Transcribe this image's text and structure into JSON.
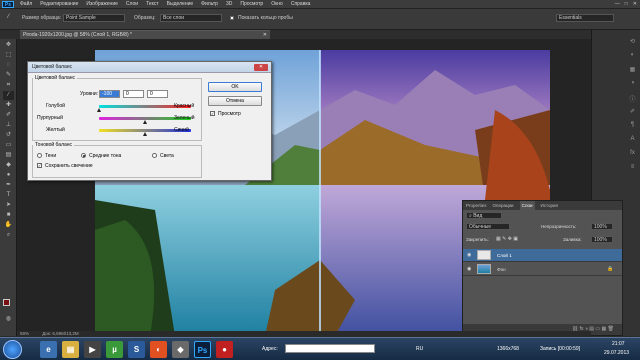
{
  "menubar": {
    "app_logo": "Ps",
    "items": [
      "Файл",
      "Редактирование",
      "Изображение",
      "Слои",
      "Текст",
      "Выделение",
      "Фильтр",
      "3D",
      "Просмотр",
      "Окно",
      "Справка"
    ],
    "win_min": "—",
    "win_max": "□",
    "win_close": "✕"
  },
  "options": {
    "sample_size_label": "Размер образца:",
    "sample_size_value": "Point Sample",
    "sample_label": "Образец:",
    "sample_value": "Все слои",
    "show_ring_label": "Показать кольцо пробы",
    "workspace": "Essentials"
  },
  "document": {
    "tab_title": "Piroda-1920x1200.jpg @ 58% (Слой 1, RGB/8) *",
    "tab_close": "✕",
    "zoom": "58%",
    "doc_size": "Док: 6,59M/13,2M"
  },
  "dialog": {
    "title": "Цветовой баланс",
    "color_balance_group": "Цветовой баланс",
    "levels_label": "Уровни:",
    "levels": [
      "-100",
      "0",
      "0"
    ],
    "sliders": [
      {
        "left": "Голубой",
        "right": "Красный",
        "value": -100
      },
      {
        "left": "Пурпурный",
        "right": "Зеленый",
        "value": 0
      },
      {
        "left": "Желтый",
        "right": "Синий",
        "value": 0
      }
    ],
    "tone_group": "Тоновой баланс",
    "tones": [
      "Тени",
      "Средние тона",
      "Света"
    ],
    "tone_selected": "Средние тона",
    "preserve_luminosity": "Сохранить свечение",
    "ok": "OK",
    "cancel": "Отмена",
    "preview": "Просмотр"
  },
  "layers_panel": {
    "tabs": [
      "Properties",
      "Операции",
      "Слои",
      "История"
    ],
    "active_tab": "Слои",
    "kind_label": "Вид",
    "blend_mode": "Обычные",
    "opacity_label": "Непрозрачность:",
    "opacity_value": "100%",
    "lock_label": "Закрепить:",
    "fill_label": "Заливка:",
    "fill_value": "100%",
    "layers": [
      {
        "name": "Слой 1",
        "selected": true
      },
      {
        "name": "Фон",
        "selected": false
      }
    ]
  },
  "taskbar": {
    "address_label": "Адрес:",
    "lang": "RU",
    "resolution": "1366x768",
    "recording": "Запись [00:00:59]",
    "time": "21:07",
    "date": "29.07.2013"
  },
  "colors": {
    "ui_dark": "#3b3b3b",
    "accent": "#3a7bd5",
    "dialog_bg": "#f0f0f0"
  }
}
